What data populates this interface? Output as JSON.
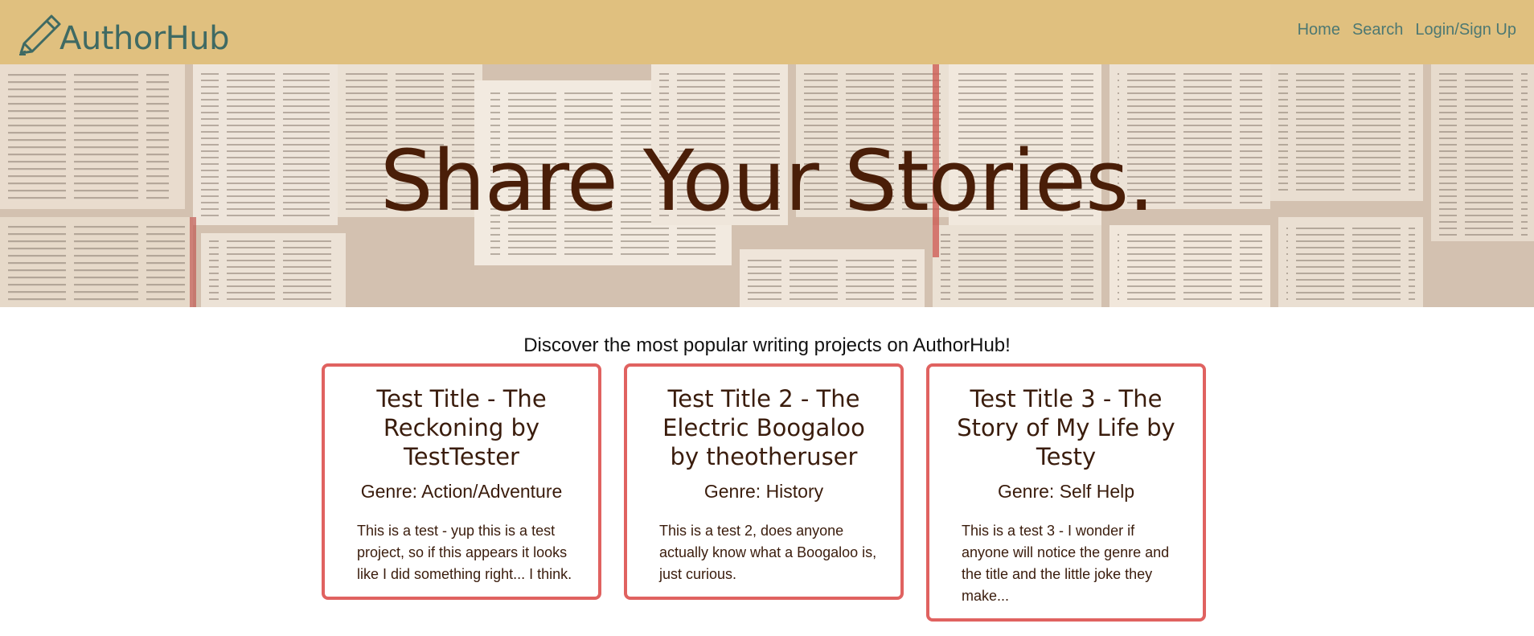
{
  "brand": {
    "name": "AuthorHub",
    "icon": "pencil-icon"
  },
  "nav": {
    "items": [
      "Home",
      "Search",
      "Login/Sign Up"
    ]
  },
  "hero": {
    "title": "Share Your Stories."
  },
  "main": {
    "tagline": "Discover the most popular writing projects on AuthorHub!",
    "cards": [
      {
        "title": "Test Title - The Reckoning by TestTester",
        "genre": "Genre: Action/Adventure",
        "description": "This is a test - yup this is a test project, so if this appears it looks like I did something right... I think."
      },
      {
        "title": "Test Title 2 - The Electric Boogaloo by theotheruser",
        "genre": "Genre: History",
        "description": "This is a test 2, does anyone actually know what a Boogaloo is, just curious."
      },
      {
        "title": "Test Title 3 - The Story of My Life by Testy",
        "genre": "Genre: Self Help",
        "description": "This is a test 3 - I wonder if anyone will notice the genre and the title and the little joke they make..."
      }
    ]
  },
  "colors": {
    "navbar": "#e0c07f",
    "brand": "#3f6a63",
    "accent": "#e06260",
    "heading": "#4a1e08"
  }
}
